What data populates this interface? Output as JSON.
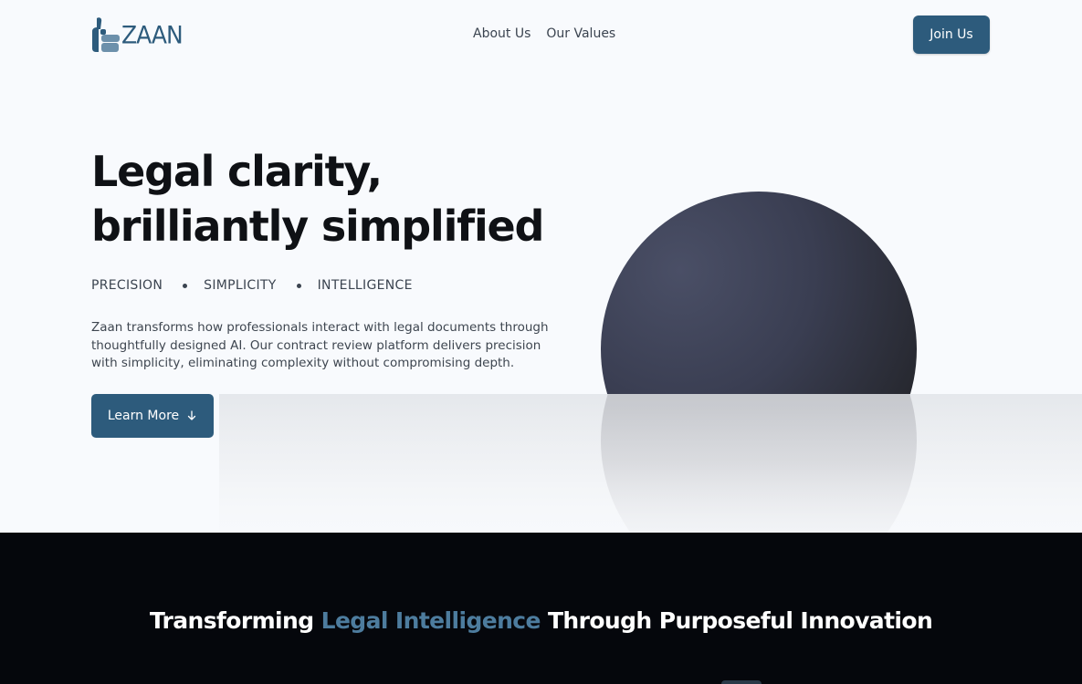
{
  "header": {
    "logo_text": "ZAAN",
    "nav_links": [
      "About Us",
      "Our Values"
    ],
    "join_label": "Join Us"
  },
  "hero": {
    "title_line1": "Legal clarity,",
    "title_line2": "brilliantly simplified",
    "tags": [
      "PRECISION",
      "SIMPLICITY",
      "INTELLIGENCE"
    ],
    "description": "Zaan transforms how professionals interact with legal documents through thoughtfully designed AI. Our contract review platform delivers precision with simplicity, eliminating complexity without compromising depth.",
    "cta_label": "Learn More"
  },
  "section2": {
    "title_before": "Transforming ",
    "title_accent": "Legal Intelligence",
    "title_after": " Through Purposeful Innovation"
  },
  "colors": {
    "brand": "#2d5b7c",
    "accent": "#4d7c9e",
    "dark_bg": "#05070c",
    "page_bg": "#f8fafd"
  },
  "icons": {
    "cta_icon": "arrow-down-icon",
    "logo_icon": "thumbs-up-logo-icon"
  }
}
